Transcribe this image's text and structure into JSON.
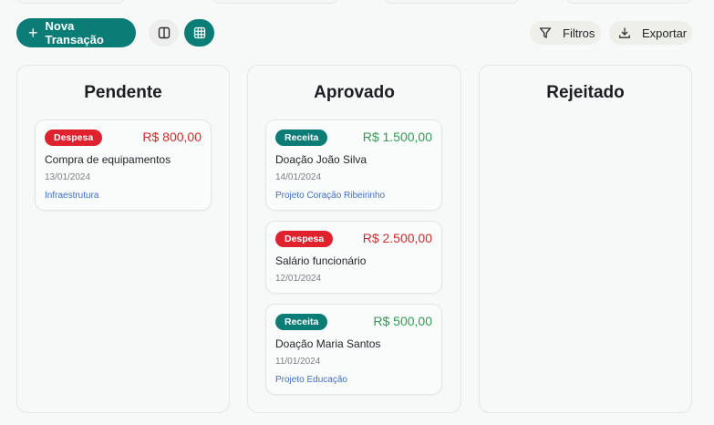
{
  "toolbar": {
    "new_transaction_label": "Nova Transação",
    "filters_label": "Filtros",
    "export_label": "Exportar"
  },
  "colors": {
    "primary": "#0b7d76",
    "expense": "#e0222f",
    "income_badge": "#0b7d76",
    "income_amount": "#2e9e4f",
    "expense_amount": "#d42a2a",
    "project_link": "#3f6fc9"
  },
  "columns": [
    {
      "title": "Pendente",
      "cards": [
        {
          "type": "Despesa",
          "amount": "R$ 800,00",
          "description": "Compra de equipamentos",
          "date": "13/01/2024",
          "project": "Infraestrutura"
        }
      ]
    },
    {
      "title": "Aprovado",
      "cards": [
        {
          "type": "Receita",
          "amount": "R$ 1.500,00",
          "description": "Doação João Silva",
          "date": "14/01/2024",
          "project": "Projeto Coração Ribeirinho"
        },
        {
          "type": "Despesa",
          "amount": "R$ 2.500,00",
          "description": "Salário funcionário",
          "date": "12/01/2024",
          "project": ""
        },
        {
          "type": "Receita",
          "amount": "R$ 500,00",
          "description": "Doação Maria Santos",
          "date": "11/01/2024",
          "project": "Projeto Educação"
        }
      ]
    },
    {
      "title": "Rejeitado",
      "cards": []
    }
  ]
}
